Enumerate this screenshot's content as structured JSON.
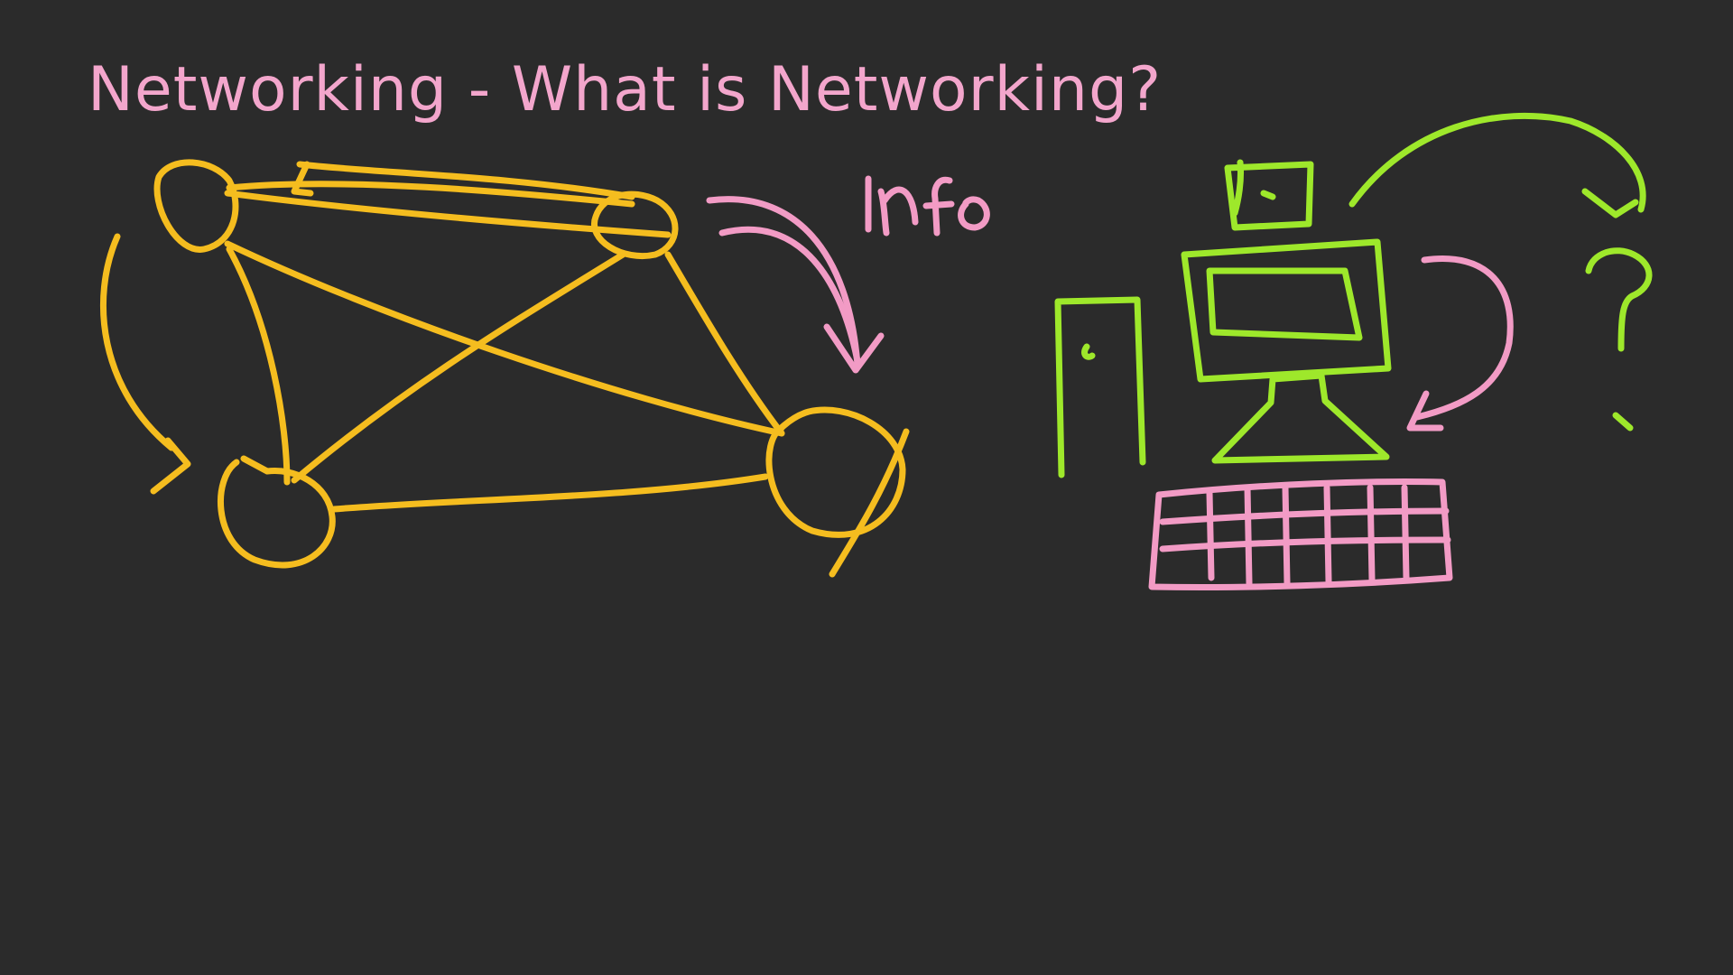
{
  "slide": {
    "title": "Networking - What is Networking?"
  },
  "colors": {
    "background": "#2b2b2b",
    "title": "#f3a6cc",
    "network_ink": "#f5bd1f",
    "info_ink": "#f29bc5",
    "computer_ink": "#9ee82b",
    "keyboard_ink": "#f29bc5"
  },
  "annotations": {
    "info_label": "info",
    "question_mark": "?"
  },
  "icons": {
    "network": "network-graph-icon",
    "computer": "desktop-computer-icon",
    "keyboard": "keyboard-icon",
    "tower": "computer-tower-icon",
    "question": "question-mark-icon"
  }
}
